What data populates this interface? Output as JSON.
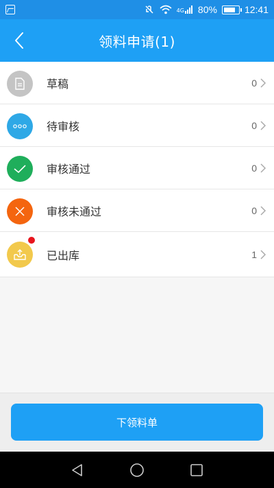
{
  "status_bar": {
    "signal_type": "4G",
    "battery": "80%",
    "time": "12:41"
  },
  "header": {
    "title": "领料申请(1)"
  },
  "list": [
    {
      "label": "草稿",
      "count": "0",
      "icon": "document-icon",
      "color": "#c4c4c4"
    },
    {
      "label": "待审核",
      "count": "0",
      "icon": "more-dots-icon",
      "color": "#2ea8e6"
    },
    {
      "label": "审核通过",
      "count": "0",
      "icon": "check-icon",
      "color": "#1fae5b"
    },
    {
      "label": "审核未通过",
      "count": "0",
      "icon": "close-icon",
      "color": "#f4650f"
    },
    {
      "label": "已出库",
      "count": "1",
      "icon": "outbox-icon",
      "color": "#f2c94c",
      "badge": true
    }
  ],
  "bottom": {
    "button_label": "下领料单"
  },
  "colors": {
    "primary": "#1ea0f5",
    "status_bar": "#1f8fe6",
    "badge": "#e8151d"
  }
}
